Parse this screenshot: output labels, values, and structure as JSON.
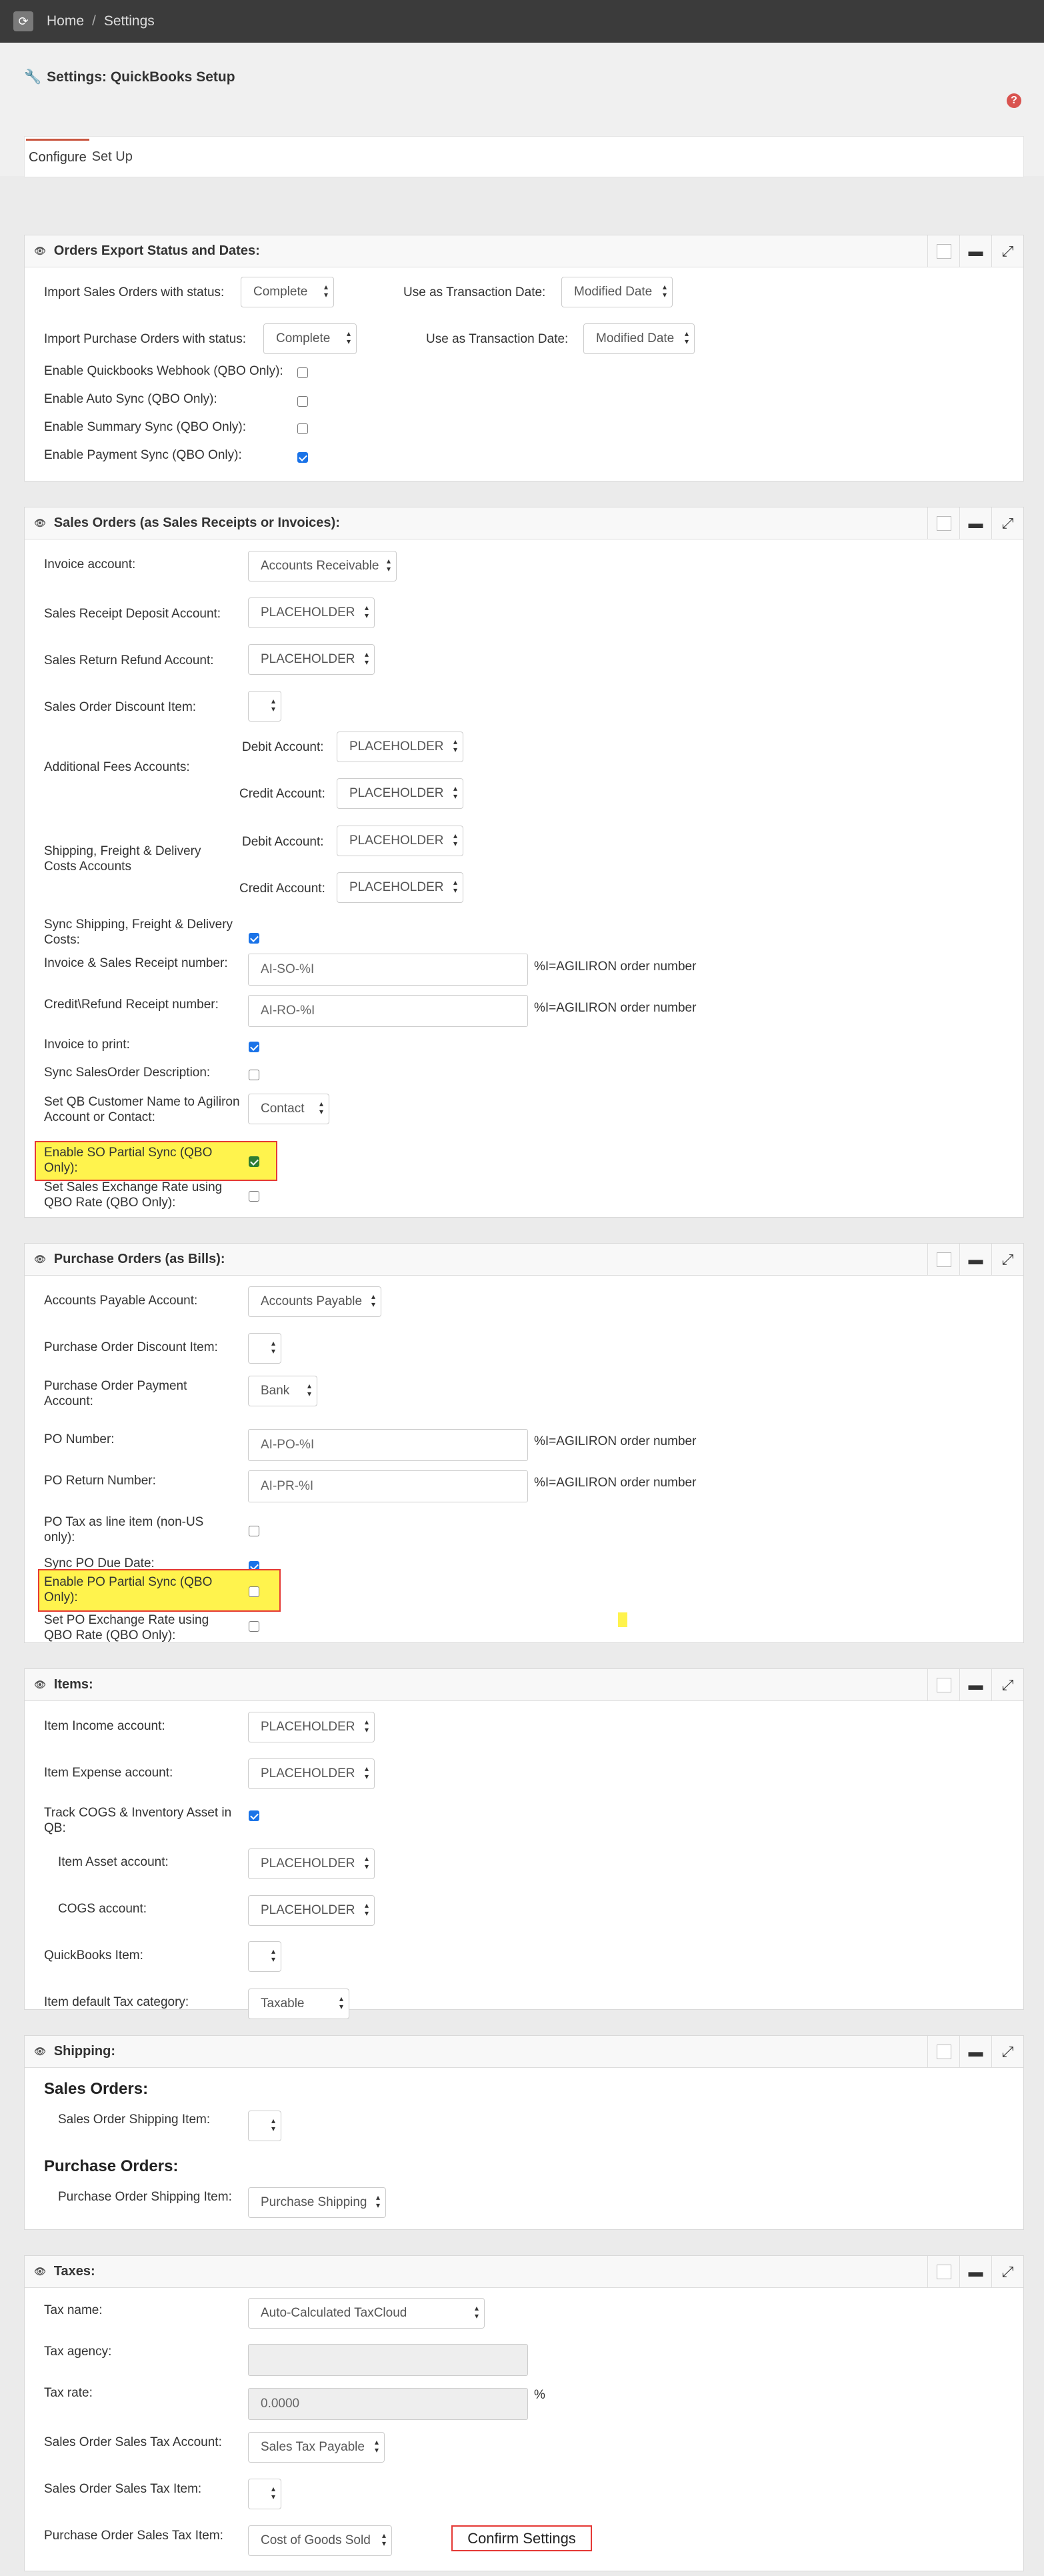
{
  "breadcrumb": {
    "home": "Home",
    "separator": "/",
    "current": "Settings"
  },
  "page": {
    "title": "Settings: QuickBooks Setup"
  },
  "tabs": [
    {
      "label": "Configure"
    },
    {
      "label": "Set Up"
    }
  ],
  "orders_export": {
    "title": "Orders Export Status and Dates:",
    "import_sales_label": "Import Sales Orders with status:",
    "import_sales_value": "Complete",
    "use_transaction_date_label": "Use as Transaction Date:",
    "sales_transaction_date_value": "Modified Date",
    "import_purchase_label": "Import Purchase Orders with status:",
    "import_purchase_value": "Complete",
    "purchase_transaction_date_value": "Modified Date",
    "webhook_label": "Enable Quickbooks Webhook (QBO Only):",
    "autosync_label": "Enable Auto Sync (QBO Only):",
    "summary_sync_label": "Enable Summary Sync (QBO Only):",
    "payment_sync_label": "Enable Payment Sync (QBO Only):"
  },
  "sales_orders": {
    "title": "Sales Orders (as Sales Receipts or Invoices):",
    "invoice_account_label": "Invoice account:",
    "invoice_account_value": "Accounts Receivable",
    "deposit_account_label": "Sales Receipt Deposit Account:",
    "deposit_account_value": "PLACEHOLDER",
    "refund_account_label": "Sales Return Refund Account:",
    "refund_account_value": "PLACEHOLDER",
    "discount_item_label": "Sales Order Discount Item:",
    "additional_fees_label": "Additional Fees Accounts:",
    "debit_account_label": "Debit Account:",
    "credit_account_label": "Credit Account:",
    "fees_debit_value": "PLACEHOLDER",
    "fees_credit_value": "PLACEHOLDER",
    "shipping_accounts_label": "Shipping, Freight & Delivery Costs Accounts",
    "shipping_debit_value": "PLACEHOLDER",
    "shipping_credit_value": "PLACEHOLDER",
    "sync_shipping_label": "Sync Shipping, Freight & Delivery Costs:",
    "invoice_number_label": "Invoice & Sales Receipt number:",
    "invoice_number_value": "AI-SO-%I",
    "refund_receipt_label": "Credit\\Refund Receipt number:",
    "refund_receipt_value": "AI-RO-%I",
    "order_number_hint": "%I=AGILIRON order number",
    "invoice_to_print_label": "Invoice to print:",
    "sync_description_label": "Sync SalesOrder Description:",
    "customer_name_label": "Set QB Customer Name to Agiliron Account or Contact:",
    "customer_name_value": "Contact",
    "partial_sync_label": "Enable SO Partial Sync (QBO Only):",
    "exchange_rate_label": "Set Sales Exchange Rate using QBO Rate (QBO Only):"
  },
  "purchase_orders": {
    "title": "Purchase Orders (as Bills):",
    "ap_account_label": "Accounts Payable Account:",
    "ap_account_value": "Accounts Payable",
    "discount_item_label": "Purchase Order Discount Item:",
    "payment_account_label": "Purchase Order Payment Account:",
    "payment_account_value": "Bank",
    "po_number_label": "PO Number:",
    "po_number_value": "AI-PO-%I",
    "po_return_label": "PO Return Number:",
    "po_return_value": "AI-PR-%I",
    "order_number_hint": "%I=AGILIRON order number",
    "po_tax_label": "PO Tax as line item (non-US only):",
    "sync_due_date_label": "Sync PO Due Date:",
    "partial_sync_label": "Enable PO Partial Sync (QBO Only):",
    "exchange_rate_label": "Set PO Exchange Rate using QBO Rate (QBO Only):"
  },
  "items": {
    "title": "Items:",
    "income_label": "Item Income account:",
    "income_value": "PLACEHOLDER",
    "expense_label": "Item Expense account:",
    "expense_value": "PLACEHOLDER",
    "track_cogs_label": "Track COGS & Inventory Asset in QB:",
    "asset_label": "Item Asset account:",
    "asset_value": "PLACEHOLDER",
    "cogs_label": "COGS account:",
    "cogs_value": "PLACEHOLDER",
    "qb_item_label": "QuickBooks Item:",
    "tax_category_label": "Item default Tax category:",
    "tax_category_value": "Taxable"
  },
  "shipping": {
    "title": "Shipping:",
    "sales_heading": "Sales Orders:",
    "sales_item_label": "Sales Order Shipping Item:",
    "purchase_heading": "Purchase Orders:",
    "purchase_item_label": "Purchase Order Shipping Item:",
    "purchase_item_value": "Purchase Shipping"
  },
  "taxes": {
    "title": "Taxes:",
    "tax_name_label": "Tax name:",
    "tax_name_value": "Auto-Calculated TaxCloud",
    "tax_agency_label": "Tax agency:",
    "tax_rate_label": "Tax rate:",
    "tax_rate_value": "0.0000",
    "percent": "%",
    "so_tax_account_label": "Sales Order Sales Tax Account:",
    "so_tax_account_value": "Sales Tax Payable",
    "so_tax_item_label": "Sales Order Sales Tax Item:",
    "po_tax_item_label": "Purchase Order Sales Tax Item:",
    "po_tax_item_value": "Cost of Goods Sold"
  },
  "footer": {
    "confirm_label": "Confirm Settings"
  },
  "checkbox_states": {
    "webhook": false,
    "autosync": false,
    "summary_sync": false,
    "payment_sync": true,
    "sync_shipping": true,
    "invoice_to_print": true,
    "sync_description": false,
    "so_partial_sync": true,
    "so_exchange_rate": false,
    "po_tax": false,
    "po_due_date": true,
    "po_partial_sync": false,
    "po_exchange_rate": false,
    "track_cogs": true
  },
  "colors": {
    "accent": "#c9553f",
    "highlight": "#fff34d",
    "highlight_border": "#e53935",
    "checkbox": "#1a73e8"
  }
}
